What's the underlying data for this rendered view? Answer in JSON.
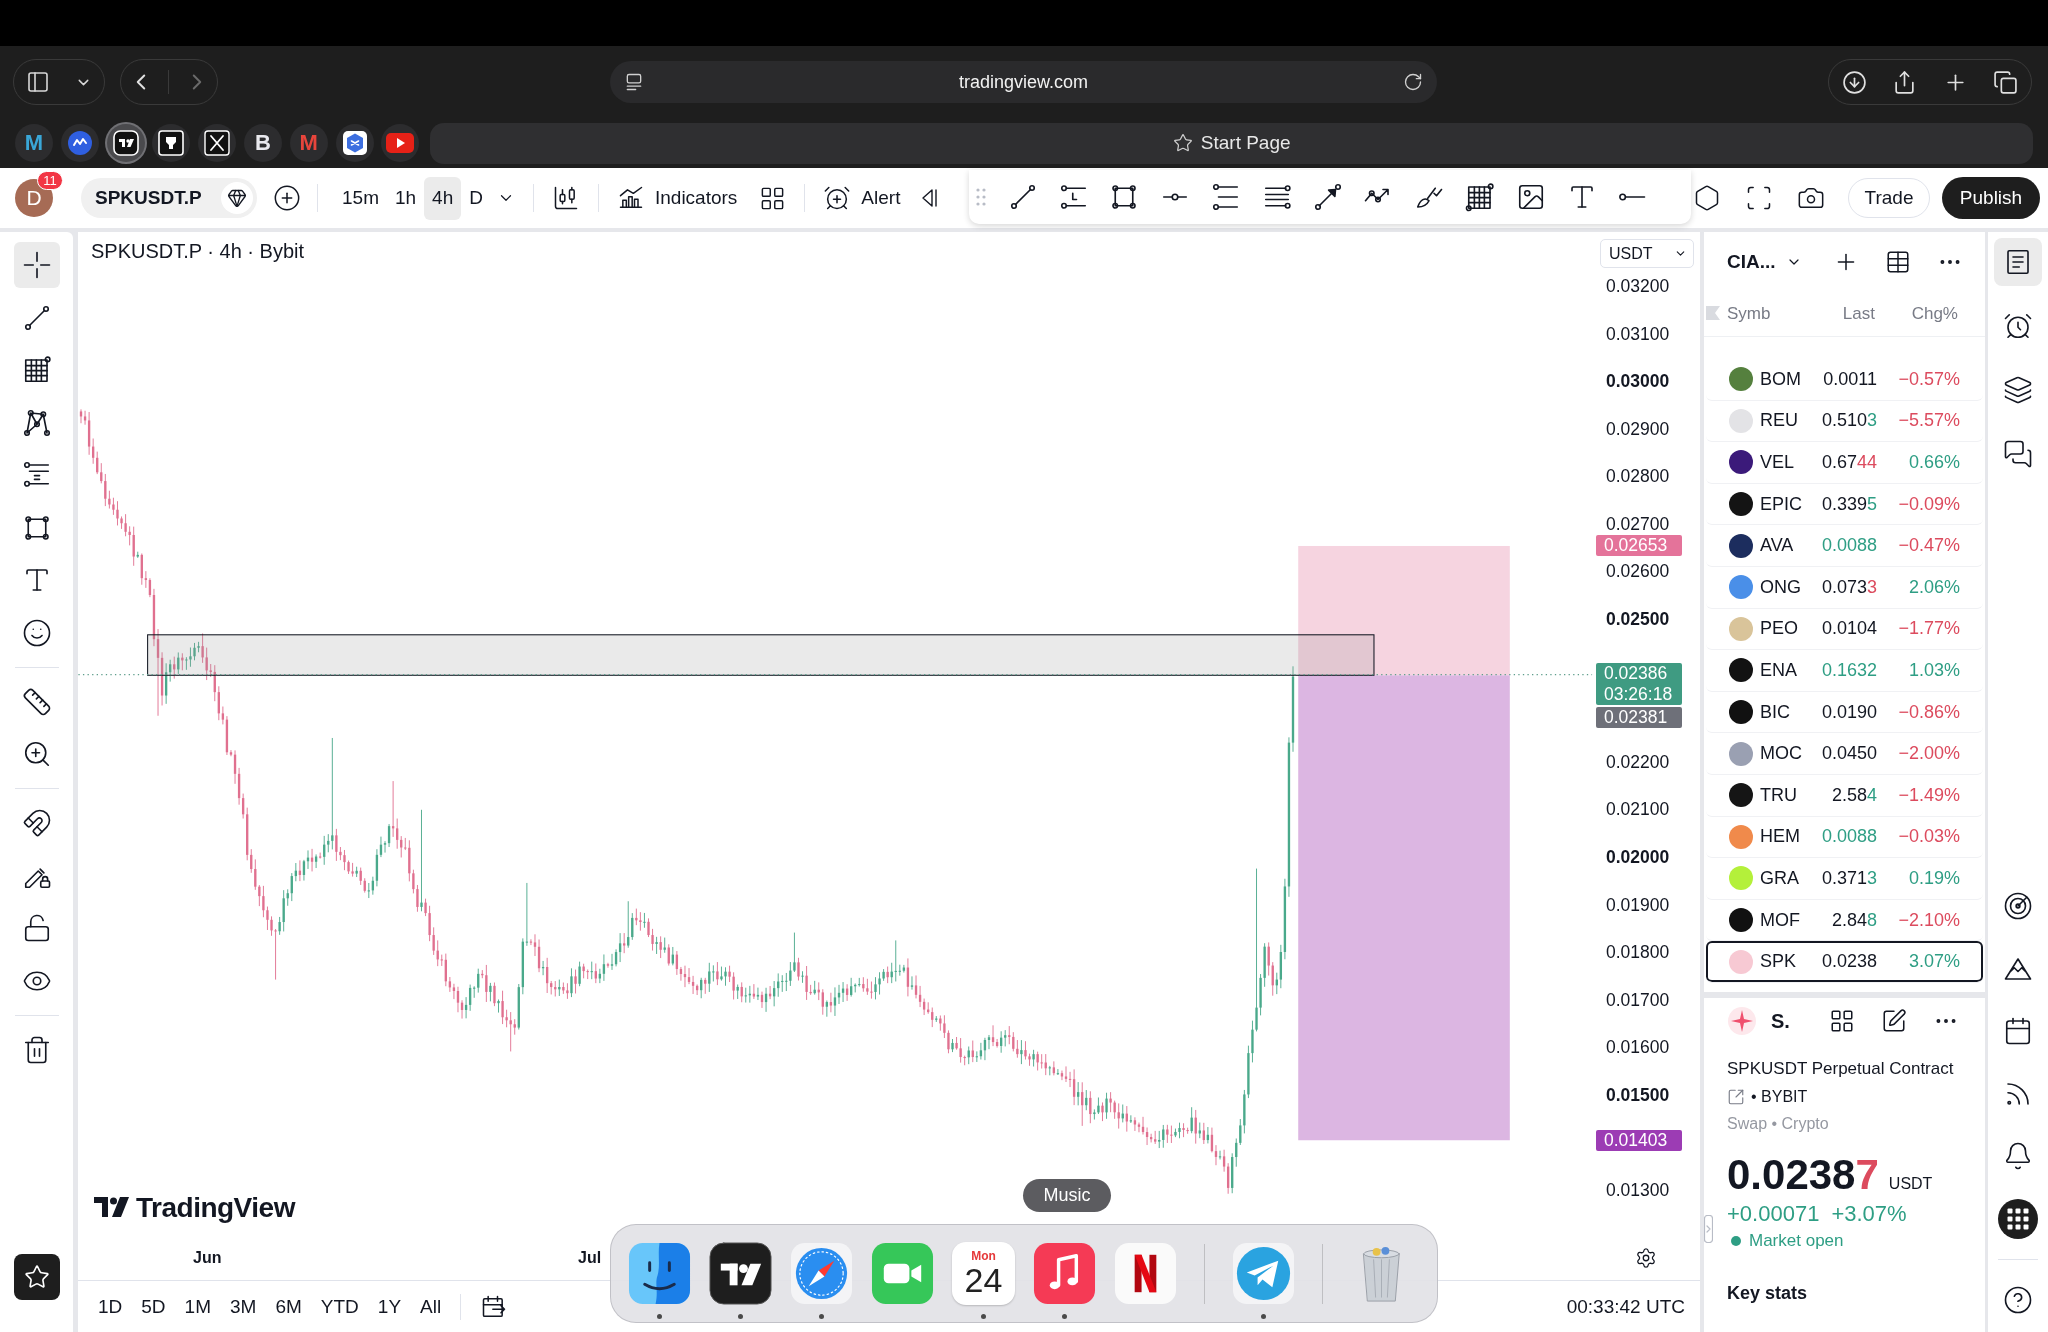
{
  "browser": {
    "navigation": {
      "back_disabled": false,
      "forward_disabled": true
    },
    "address": "tradingview.com",
    "favorites": [
      {
        "kind": "letter",
        "text": "M",
        "color": "#3aa7d8",
        "selected": false
      },
      {
        "kind": "coin",
        "color": "#2f5fe0",
        "selected": false
      },
      {
        "kind": "tv",
        "color": "#111111",
        "selected": true
      },
      {
        "kind": "pen",
        "color": "#111111",
        "selected": false
      },
      {
        "kind": "x",
        "color": "#111111",
        "selected": false
      },
      {
        "kind": "letter",
        "text": "B",
        "color": "#e9e9ee",
        "selected": false
      },
      {
        "kind": "letter",
        "text": "M",
        "color": "#e8453c",
        "selected": false
      },
      {
        "kind": "hex",
        "color": "#3d6fe0",
        "selected": false
      },
      {
        "kind": "play",
        "color": "#e62117",
        "selected": false
      }
    ],
    "tab": {
      "title": "Start Page"
    }
  },
  "toolbar": {
    "avatar": {
      "letter": "D",
      "badge": "11"
    },
    "symbol": "SPKUSDT.P",
    "intervals": [
      {
        "label": "15m",
        "selected": false
      },
      {
        "label": "1h",
        "selected": false
      },
      {
        "label": "4h",
        "selected": true
      },
      {
        "label": "D",
        "selected": false
      }
    ],
    "indicators": "Indicators",
    "alert": "Alert",
    "trade": "Trade",
    "publish": "Publish"
  },
  "left_toolbar": {
    "groups": [
      {
        "tools": [
          {
            "kind": "crosshair",
            "selected": true
          },
          {
            "kind": "trend-line",
            "selected": false
          },
          {
            "kind": "fib-grid",
            "selected": false
          },
          {
            "kind": "pattern",
            "selected": false
          },
          {
            "kind": "fib-channel",
            "selected": false
          },
          {
            "kind": "rectangle",
            "selected": false
          },
          {
            "kind": "text",
            "selected": false
          },
          {
            "kind": "emoji",
            "selected": false
          }
        ]
      },
      {
        "tools": [
          {
            "kind": "ruler",
            "selected": false
          },
          {
            "kind": "zoom",
            "selected": false
          }
        ]
      },
      {
        "tools": [
          {
            "kind": "magnet",
            "selected": false
          },
          {
            "kind": "drawing-lock",
            "selected": false
          },
          {
            "kind": "lock",
            "selected": false
          },
          {
            "kind": "eye",
            "selected": false
          }
        ]
      },
      {
        "tools": [
          {
            "kind": "trash",
            "selected": false
          }
        ]
      }
    ]
  },
  "chart": {
    "title": "SPKUSDT.P · 4h · Bybit",
    "currency": "USDT",
    "price_ticks": [
      {
        "label": "0.03200",
        "major": false
      },
      {
        "label": "0.03100",
        "major": false
      },
      {
        "label": "0.03000",
        "major": true
      },
      {
        "label": "0.02900",
        "major": false
      },
      {
        "label": "0.02800",
        "major": false
      },
      {
        "label": "0.02700",
        "major": false
      },
      {
        "label": "0.02600",
        "major": false
      },
      {
        "label": "0.02500",
        "major": true
      },
      {
        "label": "0.02200",
        "major": false
      },
      {
        "label": "0.02100",
        "major": false
      },
      {
        "label": "0.02000",
        "major": true
      },
      {
        "label": "0.01900",
        "major": false
      },
      {
        "label": "0.01800",
        "major": false
      },
      {
        "label": "0.01700",
        "major": false
      },
      {
        "label": "0.01600",
        "major": false
      },
      {
        "label": "0.01500",
        "major": true
      },
      {
        "label": "0.01300",
        "major": false
      }
    ],
    "price_badges": [
      {
        "label": "0.02653",
        "color": "#e4739a"
      },
      {
        "label": "0.02386",
        "countdown": "03:26:18",
        "color": "#3f9b82"
      },
      {
        "label": "0.02381",
        "color": "#6e7079"
      },
      {
        "label": "0.01403",
        "color": "#9c3cb4"
      }
    ],
    "time_labels": [
      "Jun",
      "Jul"
    ],
    "logo": "TradingView",
    "ranges": [
      "1D",
      "5D",
      "1M",
      "3M",
      "6M",
      "YTD",
      "1Y",
      "All"
    ],
    "clock": "00:33:42 UTC"
  },
  "watchlist": {
    "name": "CIA...",
    "columns": [
      "Symb",
      "Last",
      "Chg%"
    ],
    "rows": [
      {
        "symbol": "BOM",
        "color": "#55803e",
        "last": [
          {
            "text": "0.0011",
            "color": "#131722"
          }
        ],
        "change": "−0.57%",
        "rising": false,
        "selected": false
      },
      {
        "symbol": "REU",
        "color": "#e3e3e6",
        "last": [
          {
            "text": "0.510",
            "color": "#131722"
          },
          {
            "text": "3",
            "color": "#2e9e84"
          }
        ],
        "change": "−5.57%",
        "rising": false,
        "selected": false
      },
      {
        "symbol": "VEL",
        "color": "#3b1a7a",
        "last": [
          {
            "text": "0.67",
            "color": "#131722"
          },
          {
            "text": "44",
            "color": "#dc4b5e"
          }
        ],
        "change": "0.66%",
        "rising": true,
        "selected": false
      },
      {
        "symbol": "EPIC",
        "color": "#141414",
        "last": [
          {
            "text": "0.339",
            "color": "#131722"
          },
          {
            "text": "5",
            "color": "#2e9e84"
          }
        ],
        "change": "−0.09%",
        "rising": false,
        "selected": false
      },
      {
        "symbol": "AVA",
        "color": "#1c2d5e",
        "last": [
          {
            "text": "0.0088",
            "color": "#2e9e84"
          }
        ],
        "change": "−0.47%",
        "rising": false,
        "selected": false
      },
      {
        "symbol": "ONG",
        "color": "#4a8fe8",
        "last": [
          {
            "text": "0.073",
            "color": "#131722"
          },
          {
            "text": "3",
            "color": "#dc4b5e"
          }
        ],
        "change": "2.06%",
        "rising": true,
        "selected": false
      },
      {
        "symbol": "PEO",
        "color": "#d9c49a",
        "last": [
          {
            "text": "0.0104",
            "color": "#131722"
          }
        ],
        "change": "−1.77%",
        "rising": false,
        "selected": false
      },
      {
        "symbol": "ENA",
        "color": "#121212",
        "last": [
          {
            "text": "0.1632",
            "color": "#2e9e84"
          }
        ],
        "change": "1.03%",
        "rising": true,
        "selected": false
      },
      {
        "symbol": "BIC",
        "color": "#111111",
        "last": [
          {
            "text": "0.0190",
            "color": "#131722"
          }
        ],
        "change": "−0.86%",
        "rising": false,
        "selected": false
      },
      {
        "symbol": "MOC",
        "color": "#9aa0b2",
        "last": [
          {
            "text": "0.0450",
            "color": "#131722"
          }
        ],
        "change": "−2.00%",
        "rising": false,
        "selected": false
      },
      {
        "symbol": "TRU",
        "color": "#151515",
        "last": [
          {
            "text": "2.58",
            "color": "#131722"
          },
          {
            "text": "4",
            "color": "#2e9e84"
          }
        ],
        "change": "−1.49%",
        "rising": false,
        "selected": false
      },
      {
        "symbol": "HEM",
        "color": "#f08a4b",
        "last": [
          {
            "text": "0.0088",
            "color": "#2e9e84"
          }
        ],
        "change": "−0.03%",
        "rising": false,
        "selected": false
      },
      {
        "symbol": "GRA",
        "color": "#b4f03a",
        "last": [
          {
            "text": "0.371",
            "color": "#131722"
          },
          {
            "text": "3",
            "color": "#2e9e84"
          }
        ],
        "change": "0.19%",
        "rising": true,
        "selected": false
      },
      {
        "symbol": "MOF",
        "color": "#111111",
        "last": [
          {
            "text": "2.84",
            "color": "#131722"
          },
          {
            "text": "8",
            "color": "#2e9e84"
          }
        ],
        "change": "−2.10%",
        "rising": false,
        "selected": false
      },
      {
        "symbol": "SPK",
        "color": "#f7c9d3",
        "last": [
          {
            "text": "0.0238",
            "color": "#131722"
          }
        ],
        "change": "3.07%",
        "rising": true,
        "selected": true
      }
    ]
  },
  "details": {
    "short": "S.",
    "name": "SPKUSDT Perpetual Contract",
    "exchange": "• BYBIT",
    "category": "Swap • Crypto",
    "price": [
      {
        "text": "0.0238",
        "color": "#131722"
      },
      {
        "text": "7",
        "color": "#dc4b5e"
      }
    ],
    "currency": "USDT",
    "change": "+0.00071",
    "change_percent": "+3.07%",
    "rising": true,
    "market_status": "Market open",
    "market_open": true,
    "key_stats": "Key stats"
  },
  "side_toolbar": {
    "top": [
      {
        "kind": "watchlist",
        "selected": true
      },
      {
        "kind": "alarm",
        "selected": false
      },
      {
        "kind": "layers",
        "selected": false
      },
      {
        "kind": "chat",
        "selected": false
      }
    ],
    "bottom": [
      {
        "kind": "target",
        "selected": false
      },
      {
        "kind": "peaks",
        "selected": false
      },
      {
        "kind": "calendar",
        "selected": false
      },
      {
        "kind": "broadcast",
        "selected": false
      },
      {
        "kind": "bell",
        "selected": false
      },
      {
        "kind": "apps",
        "selected": false
      }
    ],
    "help": {
      "kind": "help",
      "selected": false
    }
  },
  "dock": {
    "tooltip": "Music",
    "groups": [
      {
        "items": [
          {
            "kind": "finder",
            "running": true
          },
          {
            "kind": "tradingview",
            "running": true
          },
          {
            "kind": "safari",
            "running": true
          },
          {
            "kind": "facetime",
            "running": false
          },
          {
            "kind": "calendar",
            "day_name": "Mon",
            "day": "24",
            "running": true
          },
          {
            "kind": "music",
            "running": true
          },
          {
            "kind": "netflix",
            "running": false
          }
        ]
      },
      {
        "items": [
          {
            "kind": "telegram",
            "running": true
          }
        ]
      },
      {
        "items": [
          {
            "kind": "trash",
            "running": false
          }
        ]
      }
    ]
  }
}
